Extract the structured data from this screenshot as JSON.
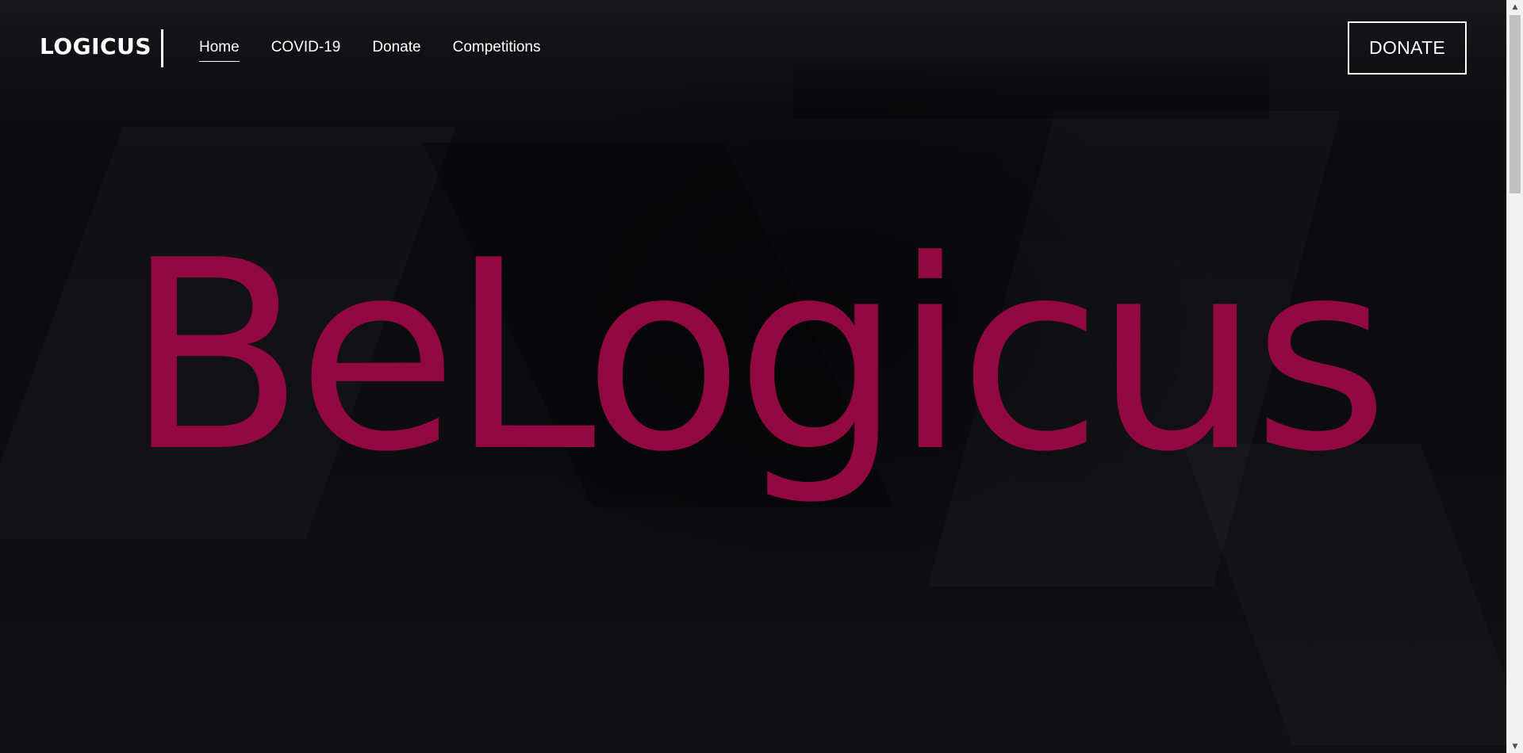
{
  "header": {
    "logo": "LOGICUS",
    "nav": [
      {
        "label": "Home",
        "active": true
      },
      {
        "label": "COVID-19",
        "active": false
      },
      {
        "label": "Donate",
        "active": false
      },
      {
        "label": "Competitions",
        "active": false
      }
    ],
    "cta_label": "DONATE"
  },
  "hero": {
    "title": "BeLogicus"
  },
  "colors": {
    "background": "#0d0d10",
    "accent": "#920841",
    "text": "#ffffff"
  },
  "scrollbar": {
    "up_icon": "triangle-up-icon",
    "down_icon": "triangle-down-icon"
  }
}
